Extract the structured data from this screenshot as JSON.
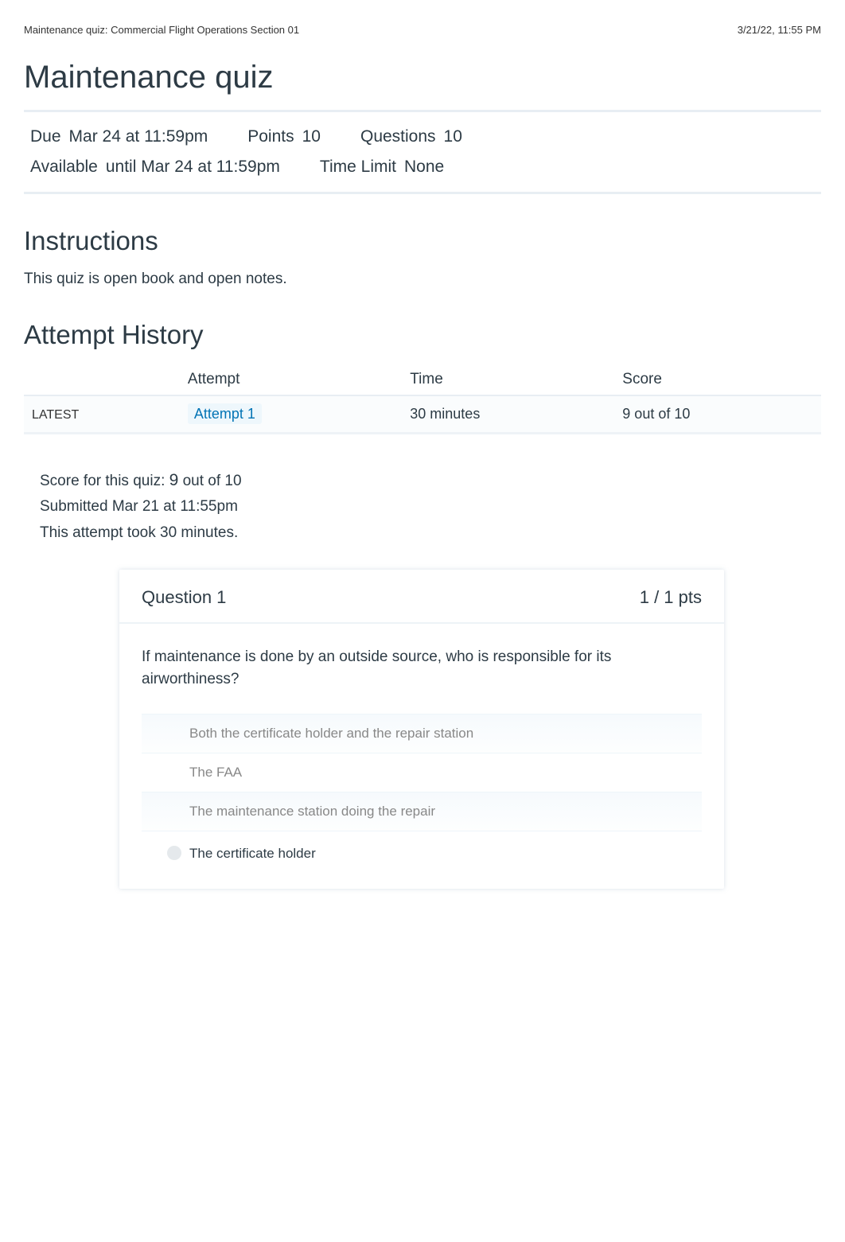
{
  "header": {
    "left": "Maintenance quiz: Commercial Flight Operations Section 01",
    "right": "3/21/22, 11:55 PM"
  },
  "title": "Maintenance quiz",
  "meta": {
    "due_label": "Due",
    "due_value": "Mar 24 at 11:59pm",
    "points_label": "Points",
    "points_value": "10",
    "questions_label": "Questions",
    "questions_value": "10",
    "available_label": "Available",
    "available_value": "until Mar 24 at 11:59pm",
    "timelimit_label": "Time Limit",
    "timelimit_value": "None"
  },
  "instructions": {
    "heading": "Instructions",
    "body": "This quiz is open book and open notes."
  },
  "attempt_history": {
    "heading": "Attempt History",
    "cols": {
      "blank": "",
      "attempt": "Attempt",
      "time": "Time",
      "score": "Score"
    },
    "rows": [
      {
        "tag": "LATEST",
        "attempt": "Attempt 1",
        "time": "30 minutes",
        "score": "9 out of 10"
      }
    ]
  },
  "summary": {
    "score_label": "Score for this quiz:",
    "score_value": "9",
    "score_suffix": "out of 10",
    "submitted": "Submitted Mar 21 at 11:55pm",
    "duration": "This attempt took 30 minutes."
  },
  "question": {
    "title": "Question 1",
    "points": "1 / 1 pts",
    "text": "If maintenance is done by an outside source, who is responsible for its airworthiness?",
    "answers": [
      {
        "text": "Both the certificate holder and the repair station",
        "correct": false
      },
      {
        "text": "The FAA",
        "correct": false
      },
      {
        "text": "The maintenance station doing the repair",
        "correct": false
      },
      {
        "text": "The certificate holder",
        "correct": true
      }
    ]
  }
}
